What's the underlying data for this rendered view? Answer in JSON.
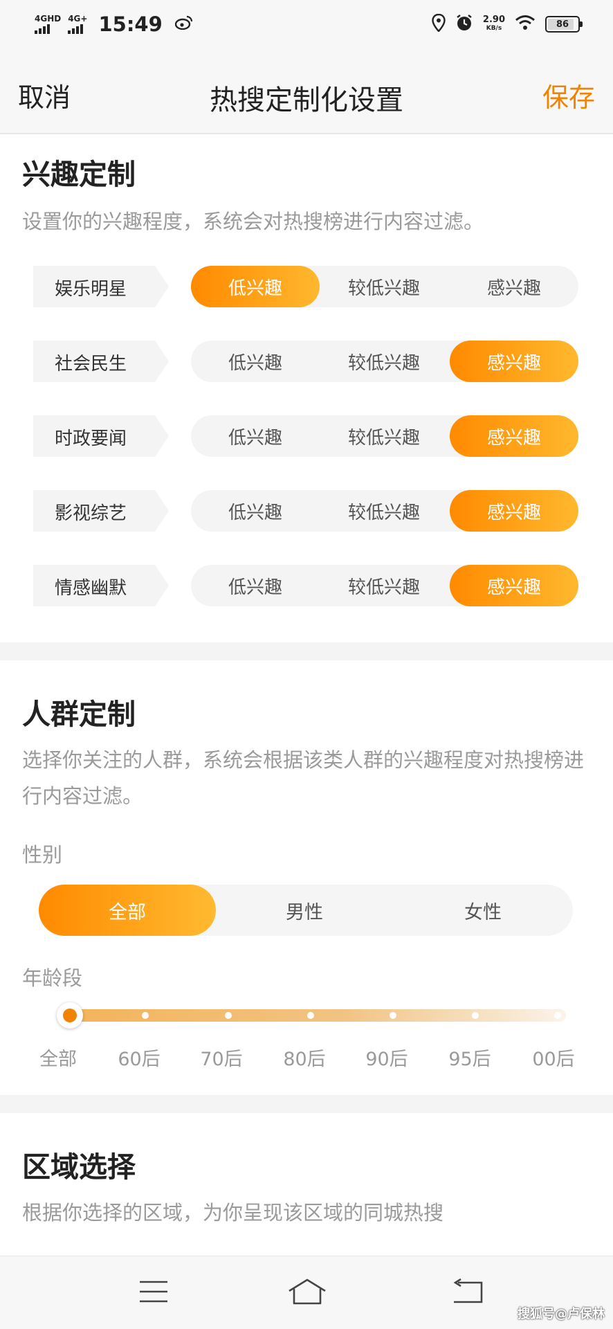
{
  "status_bar": {
    "signal1": "4GHD",
    "signal2": "4G+",
    "time": "15:49",
    "net_speed_value": "2.90",
    "net_speed_unit": "KB/s",
    "battery": "86"
  },
  "nav": {
    "cancel": "取消",
    "title": "热搜定制化设置",
    "save": "保存"
  },
  "colors": {
    "accent": "#f08300",
    "accent_light": "#ffb82e"
  },
  "interest": {
    "title": "兴趣定制",
    "desc": "设置你的兴趣程度，系统会对热搜榜进行内容过滤。",
    "options": [
      "低兴趣",
      "较低兴趣",
      "感兴趣"
    ],
    "rows": [
      {
        "label": "娱乐明星",
        "selected": 0
      },
      {
        "label": "社会民生",
        "selected": 2
      },
      {
        "label": "时政要闻",
        "selected": 2
      },
      {
        "label": "影视综艺",
        "selected": 2
      },
      {
        "label": "情感幽默",
        "selected": 2
      }
    ]
  },
  "crowd": {
    "title": "人群定制",
    "desc": "选择你关注的人群，系统会根据该类人群的兴趣程度对热搜榜进行内容过滤。",
    "gender_label": "性别",
    "gender_options": [
      "全部",
      "男性",
      "女性"
    ],
    "gender_selected": 0,
    "age_label": "年龄段",
    "age_options": [
      "全部",
      "60后",
      "70后",
      "80后",
      "90后",
      "95后",
      "00后"
    ],
    "age_selected": 0
  },
  "region": {
    "title": "区域选择",
    "desc": "根据你选择的区域，为你呈现该区域的同城热搜"
  },
  "watermark": "搜狐号@卢保林"
}
